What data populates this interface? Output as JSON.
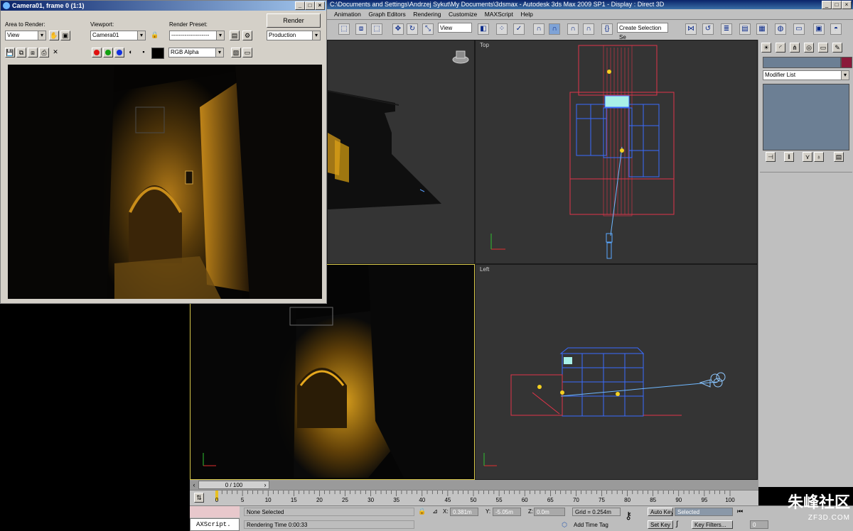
{
  "main_window": {
    "title": "C:\\Documents and Settings\\Andrzej Sykut\\My Documents\\3dsmax   - Autodesk 3ds Max  2009 SP1        - Display : Direct 3D",
    "menu": [
      "Animation",
      "Graph Editors",
      "Rendering",
      "Customize",
      "MAXScript",
      "Help"
    ],
    "toolbar": {
      "ref_coord": "View",
      "selection_set": "Create Selection Se"
    },
    "window_buttons": [
      "_",
      "□",
      "×"
    ]
  },
  "viewports": {
    "top_label": "Top",
    "left_label": "Left"
  },
  "command_panel": {
    "modifier_list": "Modifier List"
  },
  "timeline": {
    "frame_counter": "0 / 100",
    "ticks": [
      "0",
      "5",
      "10",
      "15",
      "20",
      "25",
      "30",
      "35",
      "40",
      "45",
      "50",
      "55",
      "60",
      "65",
      "70",
      "75",
      "80",
      "85",
      "90",
      "95",
      "100"
    ],
    "frame_fraction": 0
  },
  "status_bar": {
    "maxscript": "AXScript.",
    "selection": "None Selected",
    "render_time": "Rendering Time  0:00:33",
    "x_label": "X:",
    "x_value": "0.381m",
    "y_label": "Y:",
    "y_value": "-5.05m",
    "z_label": "Z:",
    "z_value": "0.0m",
    "grid": "Grid = 0.254m",
    "add_time_tag": "Add Time Tag",
    "auto_key": "Auto Key",
    "key_mode": "Selected",
    "set_key": "Set Key",
    "key_filters": "Key Filters...",
    "frame": "0"
  },
  "render_window": {
    "title": "Camera01, frame 0 (1:1)",
    "area_label": "Area to Render:",
    "area_value": "View",
    "viewport_label": "Viewport:",
    "viewport_value": "Camera01",
    "preset_label": "Render Preset:",
    "preset_value": "--------------------",
    "render_button": "Render",
    "production_value": "Production",
    "channel_value": "RGB Alpha"
  },
  "watermark": {
    "text": "朱峰社区",
    "sub": "ZF3D.COM"
  }
}
